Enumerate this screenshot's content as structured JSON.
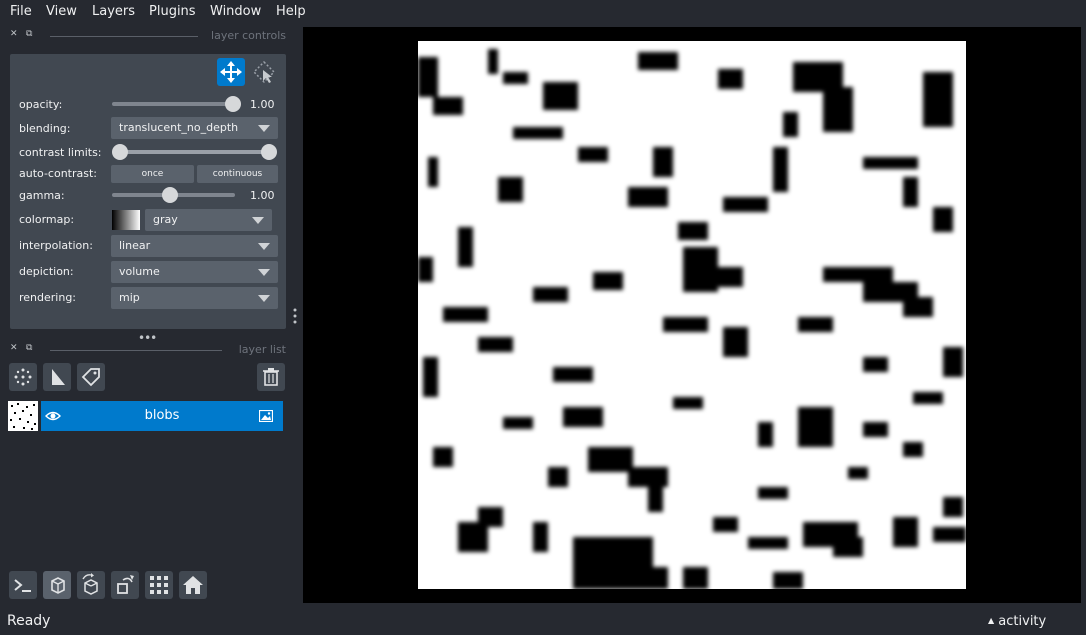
{
  "menu": {
    "file": "File",
    "view": "View",
    "layers": "Layers",
    "plugins": "Plugins",
    "window": "Window",
    "help": "Help"
  },
  "layer_controls": {
    "title": "layer controls",
    "opacity": {
      "label": "opacity:",
      "value": "1.00",
      "level": 1.0
    },
    "blending": {
      "label": "blending:",
      "value": "translucent_no_depth"
    },
    "contrast_limits": {
      "label": "contrast limits:",
      "low": 0.0,
      "high": 1.0
    },
    "auto_contrast": {
      "label": "auto-contrast:",
      "once": "once",
      "continuous": "continuous"
    },
    "gamma": {
      "label": "gamma:",
      "value": "1.00"
    },
    "colormap": {
      "label": "colormap:",
      "value": "gray"
    },
    "interpolation": {
      "label": "interpolation:",
      "value": "linear"
    },
    "depiction": {
      "label": "depiction:",
      "value": "volume"
    },
    "rendering": {
      "label": "rendering:",
      "value": "mip"
    }
  },
  "layer_list": {
    "title": "layer list",
    "layers": [
      {
        "name": "blobs",
        "visible": true,
        "selected": true
      }
    ]
  },
  "status": {
    "text": "Ready",
    "activity": "activity"
  },
  "colors": {
    "background": "#262930",
    "panel": "#414851",
    "accent": "#007acc",
    "canvas": "#000000"
  }
}
